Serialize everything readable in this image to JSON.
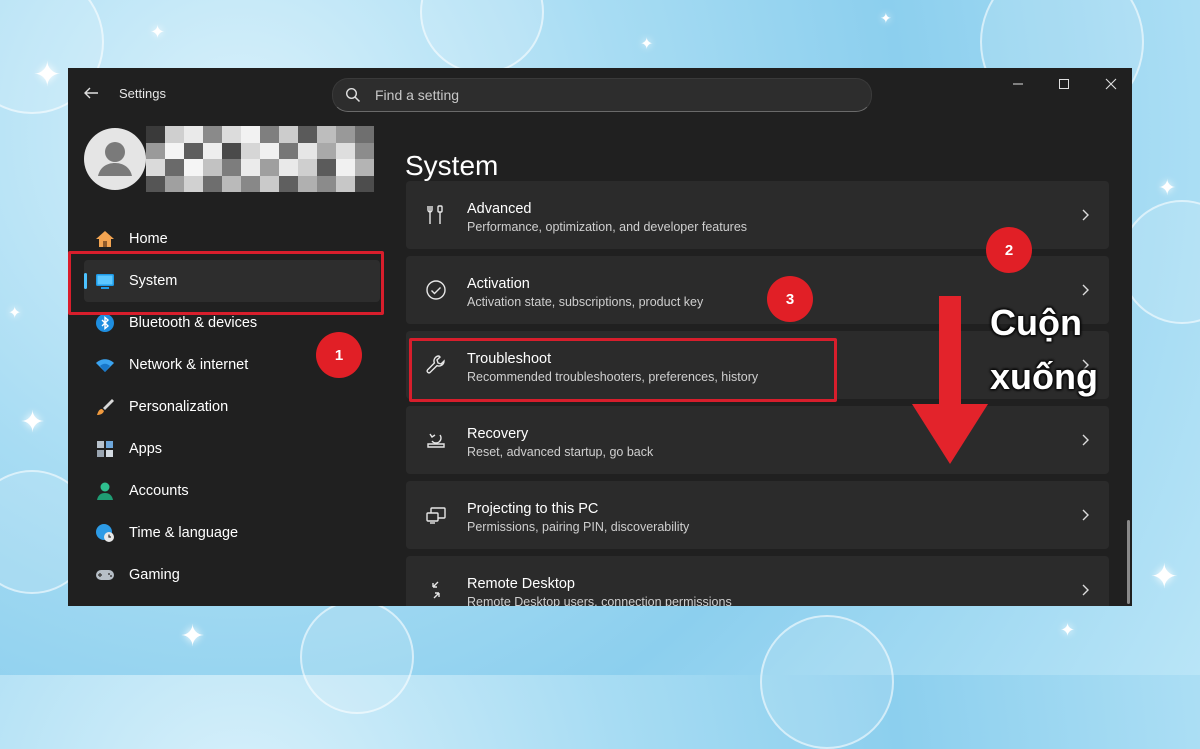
{
  "window": {
    "app_title": "Settings",
    "search": {
      "placeholder": "Find a setting"
    }
  },
  "sidebar": {
    "items": [
      {
        "label": "Home",
        "icon": "home-icon"
      },
      {
        "label": "System",
        "icon": "system-monitor-icon",
        "selected": true
      },
      {
        "label": "Bluetooth & devices",
        "icon": "bluetooth-icon"
      },
      {
        "label": "Network & internet",
        "icon": "wifi-icon"
      },
      {
        "label": "Personalization",
        "icon": "paintbrush-icon"
      },
      {
        "label": "Apps",
        "icon": "apps-icon"
      },
      {
        "label": "Accounts",
        "icon": "account-icon"
      },
      {
        "label": "Time & language",
        "icon": "globe-clock-icon"
      },
      {
        "label": "Gaming",
        "icon": "gamepad-icon"
      }
    ]
  },
  "main": {
    "title": "System",
    "cards": [
      {
        "title": "Advanced",
        "desc": "Performance, optimization, and developer features",
        "icon": "tools-icon"
      },
      {
        "title": "Activation",
        "desc": "Activation state, subscriptions, product key",
        "icon": "check-circle-icon"
      },
      {
        "title": "Troubleshoot",
        "desc": "Recommended troubleshooters, preferences, history",
        "icon": "wrench-icon"
      },
      {
        "title": "Recovery",
        "desc": "Reset, advanced startup, go back",
        "icon": "recovery-icon"
      },
      {
        "title": "Projecting to this PC",
        "desc": "Permissions, pairing PIN, discoverability",
        "icon": "projecting-icon"
      },
      {
        "title": "Remote Desktop",
        "desc": "Remote Desktop users, connection permissions",
        "icon": "remote-desktop-icon"
      }
    ]
  },
  "annotations": {
    "badge_1": "1",
    "badge_2": "2",
    "badge_3": "3",
    "scroll_line1": "Cuộn",
    "scroll_line2": "xuống",
    "highlight_color": "#d81e2c"
  },
  "colors": {
    "accent": "#4cc2ff",
    "window_bg": "#202020",
    "card_bg": "#2b2b2b"
  }
}
